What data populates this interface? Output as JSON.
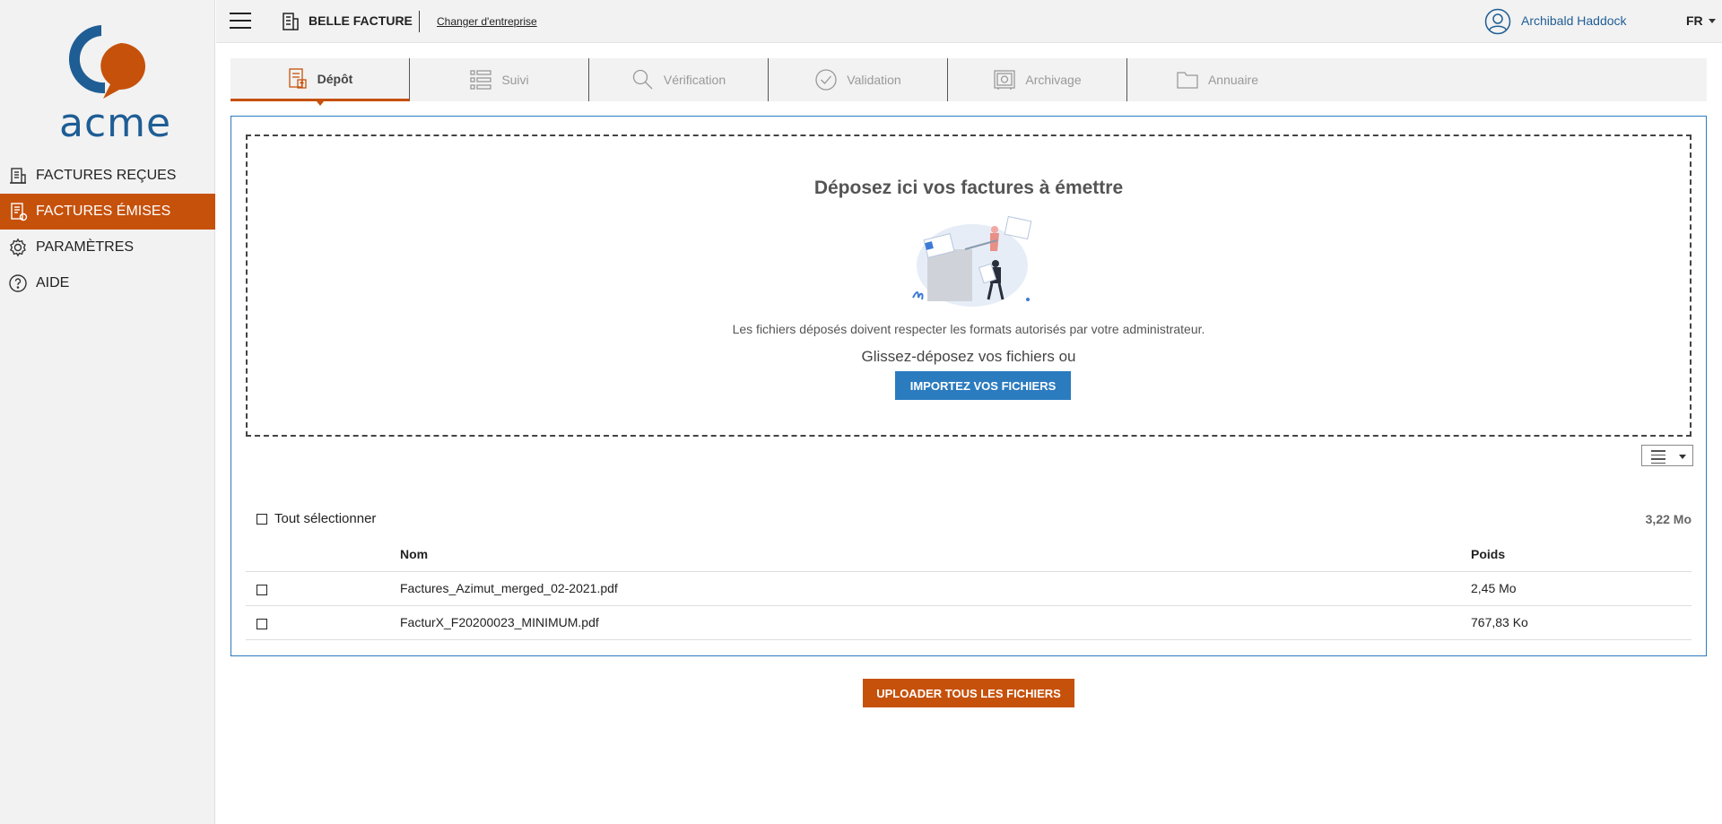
{
  "brand": {
    "logo_text": "acme",
    "logo_color": "#1f5d95",
    "logo_accent": "#c6510b"
  },
  "sidebar": {
    "items": [
      {
        "label": "FACTURES REÇUES",
        "icon": "building-invoice-icon",
        "active": false
      },
      {
        "label": "FACTURES ÉMISES",
        "icon": "invoice-euro-icon",
        "active": true
      },
      {
        "label": "PARAMÈTRES",
        "icon": "gear-icon",
        "active": false
      },
      {
        "label": "AIDE",
        "icon": "help-icon",
        "active": false
      }
    ]
  },
  "topbar": {
    "company_name": "BELLE FACTURE",
    "change_company": "Changer d'entreprise",
    "user_name": "Archibald Haddock",
    "language": "FR"
  },
  "tabs": [
    {
      "label": "Dépôt",
      "icon": "deposit-icon",
      "active": true
    },
    {
      "label": "Suivi",
      "icon": "list-icon",
      "active": false
    },
    {
      "label": "Vérification",
      "icon": "search-icon",
      "active": false
    },
    {
      "label": "Validation",
      "icon": "check-circle-icon",
      "active": false
    },
    {
      "label": "Archivage",
      "icon": "safe-icon",
      "active": false
    },
    {
      "label": "Annuaire",
      "icon": "folder-icon",
      "active": false
    }
  ],
  "dropzone": {
    "title": "Déposez ici vos factures à émettre",
    "note": "Les fichiers déposés doivent respecter les formats autorisés par votre administrateur.",
    "drag_text": "Glissez-déposez vos fichiers ou",
    "import_button": "IMPORTEZ VOS FICHIERS"
  },
  "files": {
    "select_all": "Tout sélectionner",
    "total_size": "3,22 Mo",
    "columns": {
      "name": "Nom",
      "size": "Poids"
    },
    "rows": [
      {
        "name": "Factures_Azimut_merged_02-2021.pdf",
        "size": "2,45 Mo"
      },
      {
        "name": "FacturX_F20200023_MINIMUM.pdf",
        "size": "767,83 Ko"
      }
    ]
  },
  "upload_button": "UPLOADER TOUS LES FICHIERS",
  "colors": {
    "accent": "#c6510b",
    "primary": "#2b7bbf"
  }
}
